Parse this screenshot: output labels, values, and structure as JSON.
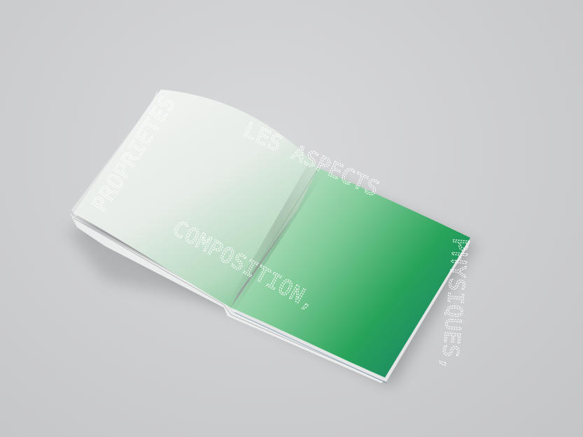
{
  "book_text": {
    "line_1": "PROPRIETES",
    "line_2": "LES ASPECTS",
    "line_3": "COMPOSITION,",
    "line_4": "PHYSIQUES,"
  },
  "colors": {
    "background": "#cfd0d2",
    "page_light": "#f3f4f3",
    "page_green": "#1f9a55",
    "page_teal": "#1b6f86",
    "text": "#ffffff"
  }
}
